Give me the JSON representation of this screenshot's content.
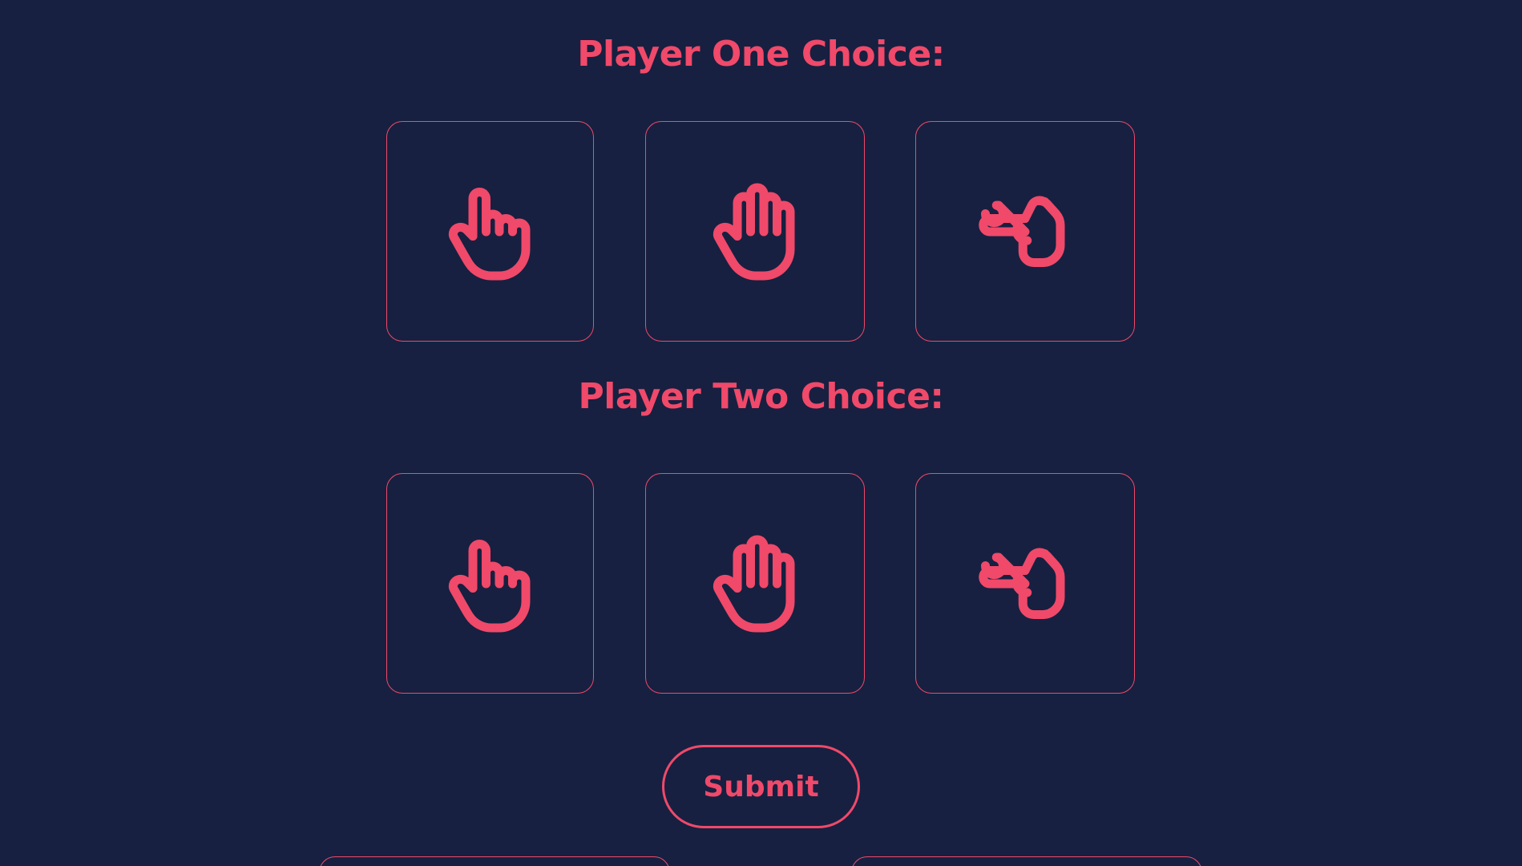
{
  "player_one": {
    "heading": "Player One Choice:",
    "choices": [
      {
        "name": "rock",
        "icon": "hand-fist-icon"
      },
      {
        "name": "paper",
        "icon": "hand-paper-icon"
      },
      {
        "name": "scissors",
        "icon": "hand-scissors-icon"
      }
    ]
  },
  "player_two": {
    "heading": "Player Two Choice:",
    "choices": [
      {
        "name": "rock",
        "icon": "hand-fist-icon"
      },
      {
        "name": "paper",
        "icon": "hand-paper-icon"
      },
      {
        "name": "scissors",
        "icon": "hand-scissors-icon"
      }
    ]
  },
  "submit": {
    "label": "Submit"
  },
  "colors": {
    "background": "#172040",
    "accent": "#f0496a"
  }
}
